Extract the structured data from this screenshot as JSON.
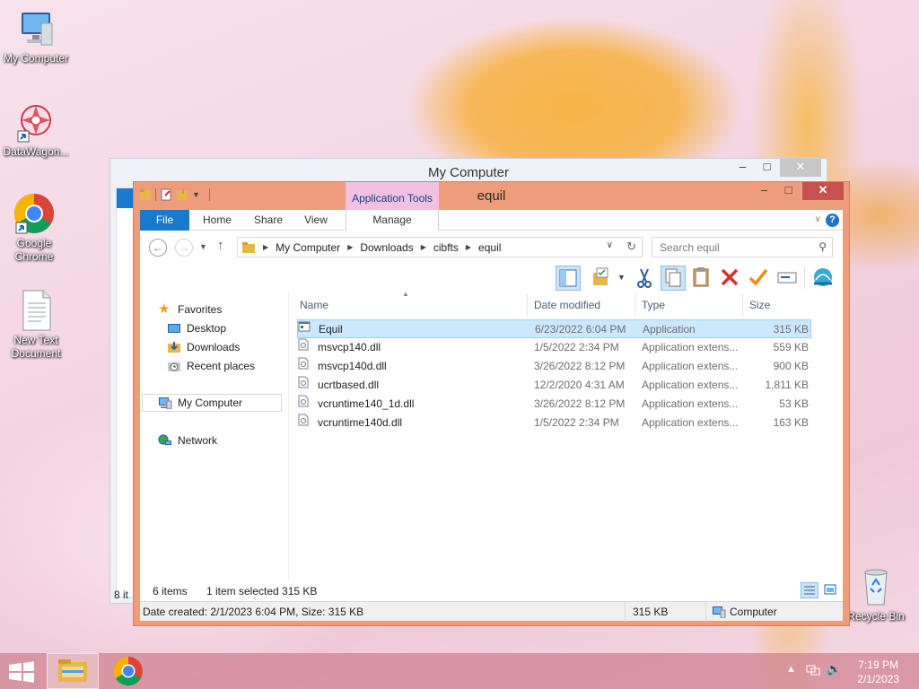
{
  "desktop": {
    "icons": [
      {
        "label": "My Computer"
      },
      {
        "label": "DataWagon..."
      },
      {
        "label": "Google Chrome"
      },
      {
        "label": "New Text Document"
      },
      {
        "label": "Recycle Bin"
      }
    ]
  },
  "back_window": {
    "title": "My Computer",
    "footer": "8 it"
  },
  "window": {
    "title": "equil",
    "context_tab": "Application Tools",
    "tabs": {
      "file": "File",
      "home": "Home",
      "share": "Share",
      "view": "View",
      "manage": "Manage"
    },
    "address": {
      "root": "My Computer",
      "p1": "Downloads",
      "p2": "cibfts",
      "p3": "equil"
    },
    "search_placeholder": "Search equil",
    "nav": {
      "favorites": "Favorites",
      "desktop": "Desktop",
      "downloads": "Downloads",
      "recent": "Recent places",
      "computer": "My Computer",
      "network": "Network"
    },
    "columns": {
      "name": "Name",
      "date": "Date modified",
      "type": "Type",
      "size": "Size"
    },
    "files": [
      {
        "name": "Equil",
        "date": "6/23/2022 6:04 PM",
        "type": "Application",
        "size": "315 KB"
      },
      {
        "name": "msvcp140.dll",
        "date": "1/5/2022 2:34 PM",
        "type": "Application extens...",
        "size": "559 KB"
      },
      {
        "name": "msvcp140d.dll",
        "date": "3/26/2022 8:12 PM",
        "type": "Application extens...",
        "size": "900 KB"
      },
      {
        "name": "ucrtbased.dll",
        "date": "12/2/2020 4:31 AM",
        "type": "Application extens...",
        "size": "1,811 KB"
      },
      {
        "name": "vcruntime140_1d.dll",
        "date": "3/26/2022 8:12 PM",
        "type": "Application extens...",
        "size": "53 KB"
      },
      {
        "name": "vcruntime140d.dll",
        "date": "1/5/2022 2:34 PM",
        "type": "Application extens...",
        "size": "163 KB"
      }
    ],
    "status": {
      "count": "6 items",
      "selected": "1 item selected  315 KB"
    },
    "details": {
      "info": "Date created: 2/1/2023 6:04 PM, Size: 315 KB",
      "size": "315 KB",
      "location": "Computer"
    }
  },
  "taskbar": {
    "time": "7:19 PM",
    "date": "2/1/2023"
  }
}
